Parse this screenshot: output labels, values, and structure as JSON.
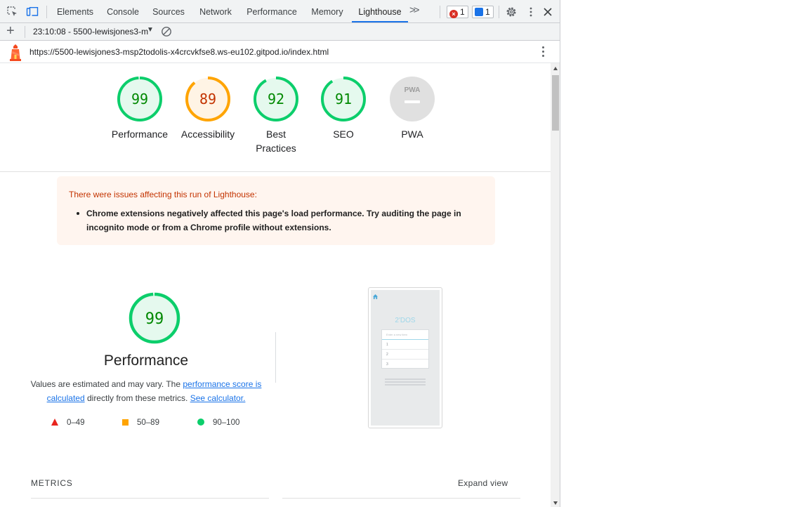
{
  "tabs": [
    {
      "label": "Elements",
      "active": false
    },
    {
      "label": "Console",
      "active": false
    },
    {
      "label": "Sources",
      "active": false
    },
    {
      "label": "Network",
      "active": false
    },
    {
      "label": "Performance",
      "active": false
    },
    {
      "label": "Memory",
      "active": false
    },
    {
      "label": "Lighthouse",
      "active": true
    }
  ],
  "badges": {
    "errors": "1",
    "messages": "1"
  },
  "toolbar": {
    "report_name": "23:10:08 - 5500-lewisjones3-m",
    "url": "https://5500-lewisjones3-msp2todolis-x4crcvkfse8.ws-eu102.gitpod.io/index.html"
  },
  "scores": [
    {
      "label": "Performance",
      "value": "99",
      "fraction": 0.99,
      "rating": "pass"
    },
    {
      "label": "Accessibility",
      "value": "89",
      "fraction": 0.89,
      "rating": "average"
    },
    {
      "label": "Best Practices",
      "value": "92",
      "fraction": 0.92,
      "rating": "pass"
    },
    {
      "label": "SEO",
      "value": "91",
      "fraction": 0.91,
      "rating": "pass"
    },
    {
      "label": "PWA",
      "value": "",
      "fraction": 0,
      "rating": "na"
    }
  ],
  "pwa_badge": "PWA",
  "warning": {
    "title": "There were issues affecting this run of Lighthouse:",
    "items": [
      "Chrome extensions negatively affected this page's load performance. Try auditing the page in incognito mode or from a Chrome profile without extensions."
    ]
  },
  "performance": {
    "score": "99",
    "fraction": 0.99,
    "title": "Performance",
    "desc_before": "Values are estimated and may vary. The ",
    "link_score": "performance score is calculated",
    "desc_middle": " directly from these metrics. ",
    "link_calc": "See calculator.",
    "legend": [
      {
        "range": "0–49",
        "shape": "triangle",
        "color": "#e8251e"
      },
      {
        "range": "50–89",
        "shape": "square",
        "color": "#ffa400"
      },
      {
        "range": "90–100",
        "shape": "circle",
        "color": "#0cce6b"
      }
    ]
  },
  "screenshot": {
    "logo": "2'DOS",
    "input_placeholder": "Enter a new item",
    "rows": [
      "1",
      "2",
      "3"
    ]
  },
  "metrics": {
    "label": "METRICS",
    "expand": "Expand view"
  },
  "colors": {
    "pass": "#0cce6b",
    "pass_text": "#008800",
    "pass_bg": "#e5f9ee",
    "average": "#ffa400",
    "average_text": "#c33300",
    "average_bg": "#fff4e5",
    "na": "#e0e0e0",
    "accent": "#1a73e8"
  },
  "icons": [
    "inspect-icon",
    "device-toolbar-icon",
    "more-tabs-icon",
    "error-icon",
    "message-icon",
    "settings-icon",
    "kebab-icon",
    "close-icon",
    "add-icon",
    "clear-icon",
    "lighthouse-logo",
    "home-icon"
  ]
}
